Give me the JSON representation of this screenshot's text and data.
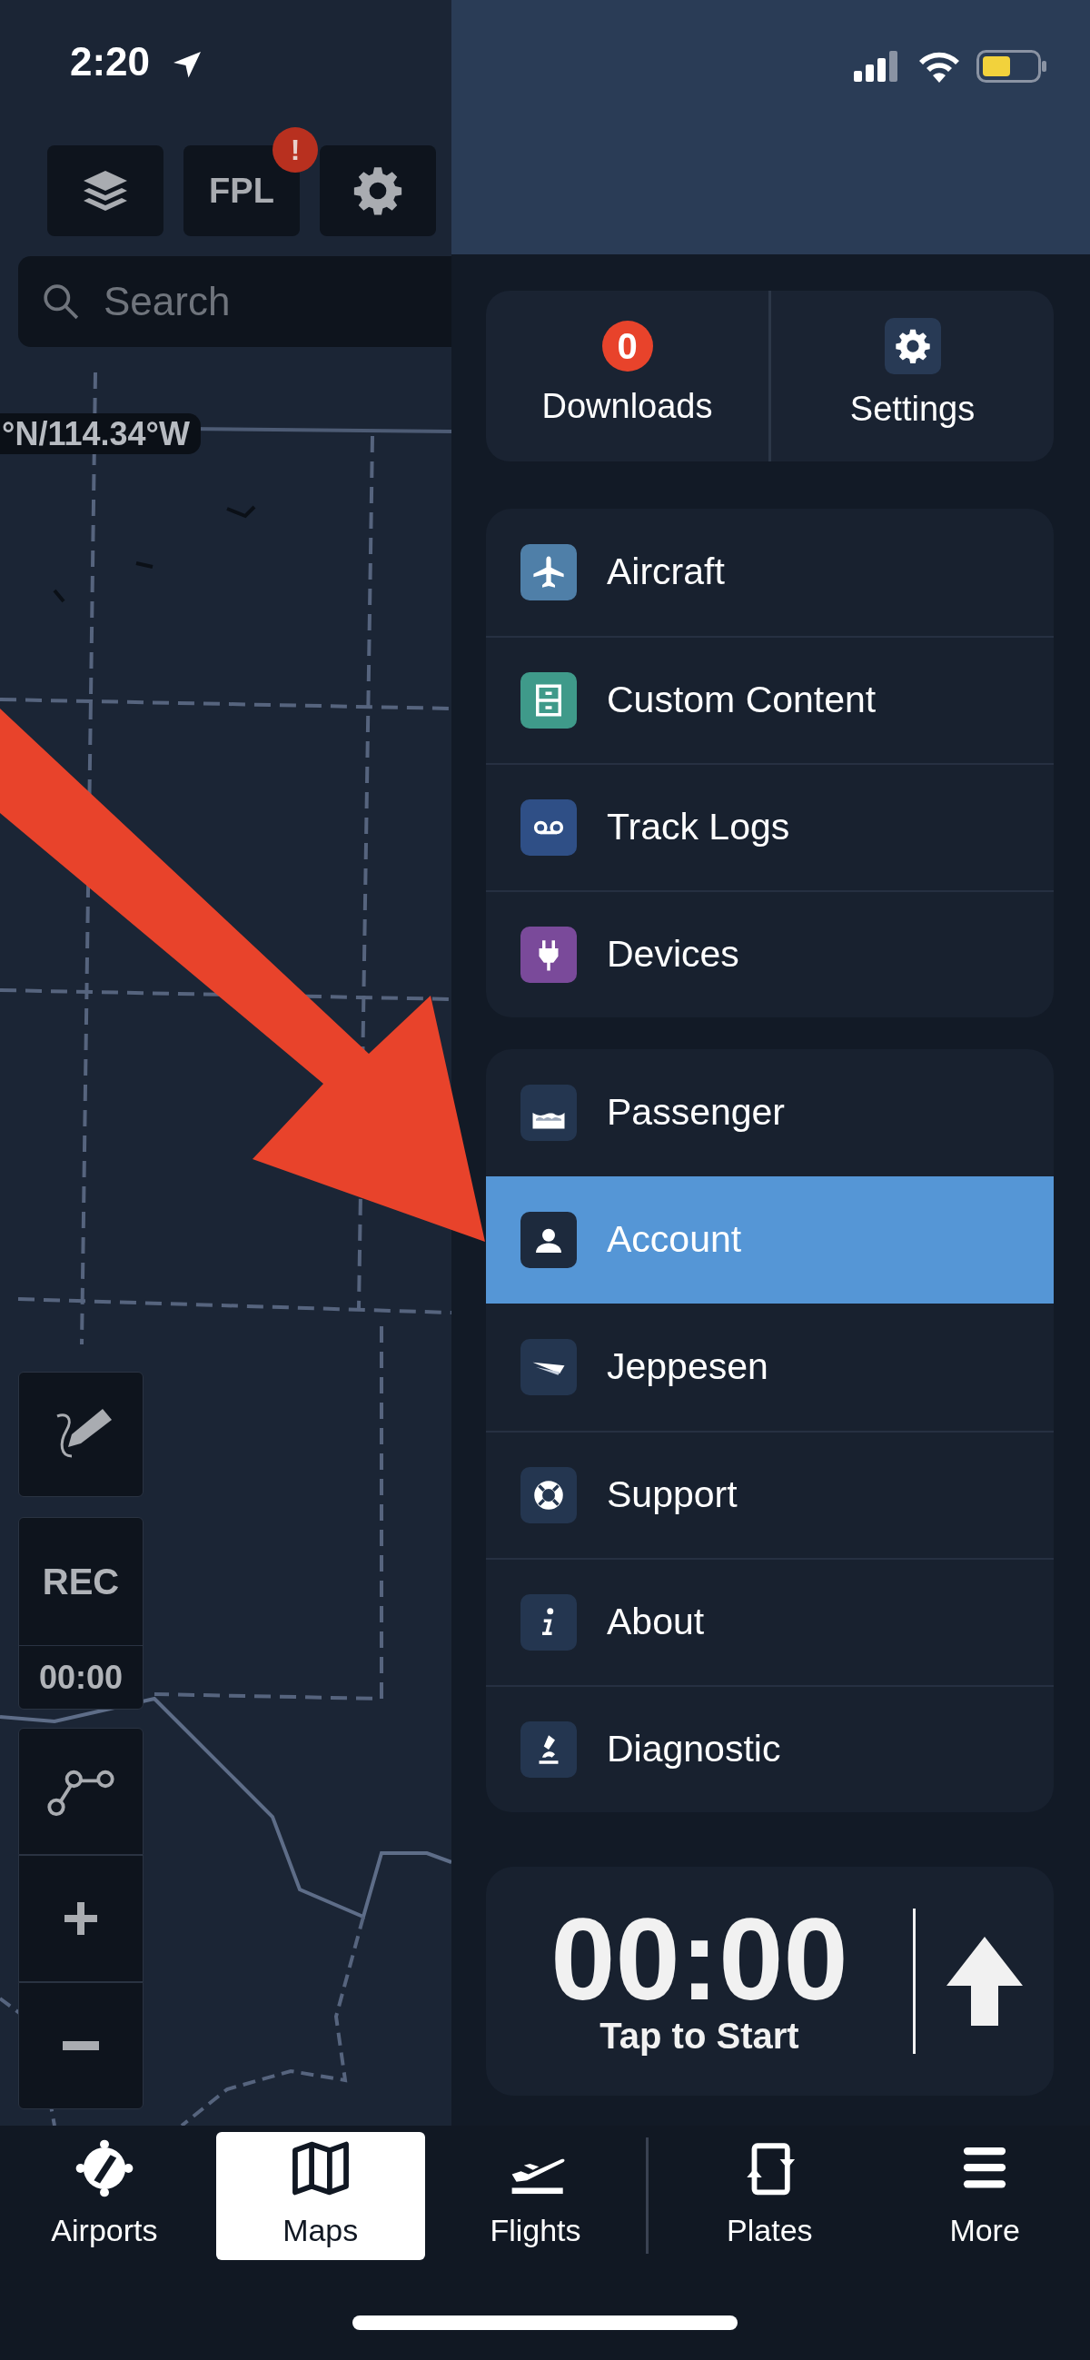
{
  "status_bar": {
    "time": "2:20"
  },
  "map_toolbar": [
    {
      "kind": "layers"
    },
    {
      "kind": "text",
      "label": "FPL",
      "badge": "!"
    },
    {
      "kind": "settings"
    }
  ],
  "search": {
    "placeholder": "Search"
  },
  "coordinates": "°N/114.34°W",
  "map_controls": {
    "rec_label": "REC",
    "rec_time": "00:00"
  },
  "quick_actions": [
    {
      "kind": "count",
      "label": "Downloads",
      "badge": "0"
    },
    {
      "kind": "settings",
      "label": "Settings"
    }
  ],
  "menu_groups": [
    {
      "items": [
        {
          "kind": "aircraft",
          "label": "Aircraft",
          "selected": false
        },
        {
          "kind": "content",
          "label": "Custom Content",
          "selected": false
        },
        {
          "kind": "tracklogs",
          "label": "Track Logs",
          "selected": false
        },
        {
          "kind": "devices",
          "label": "Devices",
          "selected": false
        }
      ]
    },
    {
      "items": [
        {
          "kind": "passenger",
          "label": "Passenger",
          "selected": false
        },
        {
          "kind": "account",
          "label": "Account",
          "selected": true
        },
        {
          "kind": "jeppesen",
          "label": "Jeppesen",
          "selected": false
        },
        {
          "kind": "support",
          "label": "Support",
          "selected": false
        },
        {
          "kind": "about",
          "label": "About",
          "selected": false
        },
        {
          "kind": "diagnostic",
          "label": "Diagnostic",
          "selected": false
        }
      ]
    }
  ],
  "timer": {
    "time": "00:00",
    "caption": "Tap to Start"
  },
  "tab_bar": [
    {
      "kind": "airports",
      "label": "Airports",
      "selected": false
    },
    {
      "kind": "maps",
      "label": "Maps",
      "selected": true
    },
    {
      "kind": "flights",
      "label": "Flights",
      "selected": false
    },
    {
      "kind": "plates",
      "label": "Plates",
      "selected": false
    },
    {
      "kind": "more",
      "label": "More",
      "selected": false
    }
  ]
}
